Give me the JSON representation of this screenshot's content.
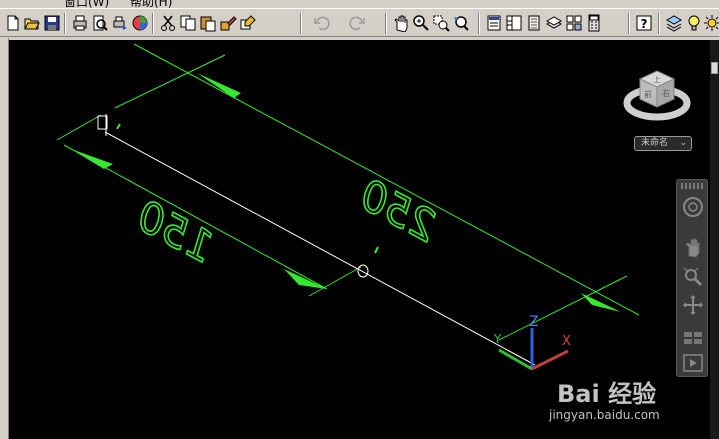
{
  "menu": {
    "items": [
      "窗口(W)",
      "帮助(H)"
    ]
  },
  "toolbar": {
    "icons": [
      "new-icon",
      "open-icon",
      "save-icon",
      "plot-icon",
      "plot-preview-icon",
      "publish-icon",
      "3d-dwf-icon",
      "cut-icon",
      "copy-icon",
      "paste-icon",
      "match-properties-icon",
      "block-editor-icon",
      "undo-icon",
      "redo-icon",
      "pan-icon",
      "zoom-realtime-icon",
      "zoom-window-icon",
      "zoom-previous-icon",
      "properties-icon",
      "design-center-icon",
      "tool-palettes-icon",
      "sheet-set-icon",
      "markup-icon",
      "quickcalc-icon",
      "help-icon",
      "layer-icon",
      "light-icon"
    ]
  },
  "viewport": {
    "background": "#000000",
    "dimension_color": "#36e830",
    "line_color": "#ffffff",
    "dimensions": [
      {
        "id": "dim-150",
        "text": "150"
      },
      {
        "id": "dim-250",
        "text": "250"
      }
    ],
    "ucs": {
      "x_label": "X",
      "y_label": "Y",
      "z_label": "Z"
    }
  },
  "viewcube": {
    "view_name": "未命名",
    "faces": [
      "前",
      "右",
      "上"
    ]
  },
  "navbar": {
    "tools": [
      "steering-wheel-icon",
      "pan-hand-icon",
      "zoom-icon",
      "orbit-icon",
      "showmotion-icon"
    ]
  },
  "watermark": {
    "line1": "Bai 经验",
    "line2": "jingyan.baidu.com"
  }
}
